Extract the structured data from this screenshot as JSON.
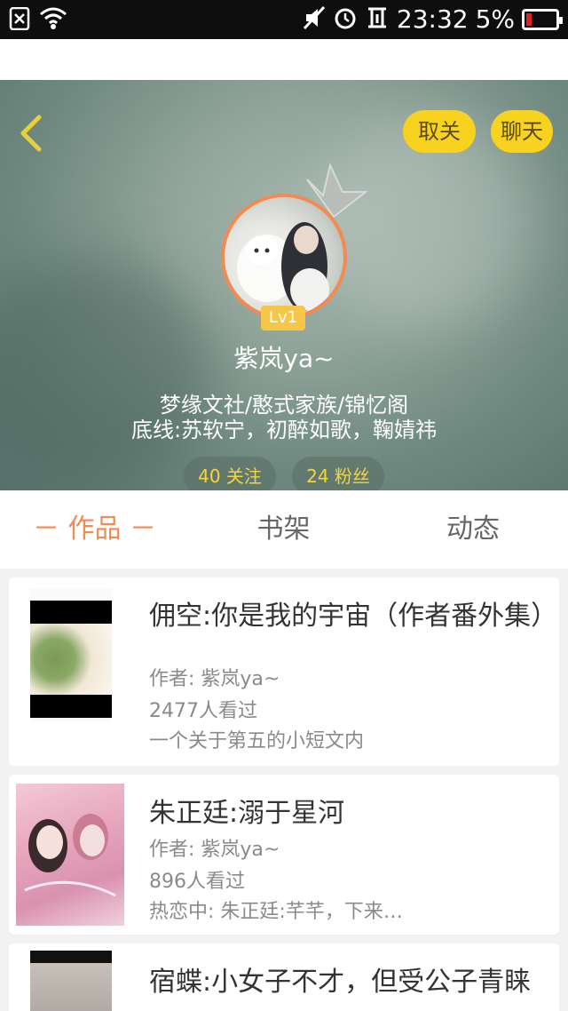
{
  "status_bar": {
    "time": "23:32",
    "battery_percent": "5%",
    "battery_color": "#e0222b",
    "icons": [
      "sim-off-icon",
      "wifi-icon",
      "mute-icon",
      "alarm-icon",
      "signal-icon"
    ]
  },
  "header": {
    "back_icon": "chevron-left-icon",
    "unfollow_label": "取关",
    "chat_label": "聊天",
    "level_badge": "Lv1",
    "username": "紫岚ya~",
    "bio_line1": "梦缘文社/憨式家族/锦忆阁",
    "bio_line2": "底线:苏软宁，初醉如歌，鞠婧祎",
    "following": "40 关注",
    "fans": "24 粉丝",
    "accent_yellow": "#f7d21e",
    "avatar_border": "#f28a52"
  },
  "tabs": [
    {
      "label": "－ 作品 －",
      "active": true
    },
    {
      "label": "书架",
      "active": false
    },
    {
      "label": "动态",
      "active": false
    }
  ],
  "works": [
    {
      "title": "佣空:你是我的宇宙（作者番外集）",
      "author": "作者: 紫岚ya~",
      "views": "2477人看过",
      "desc": "一个关于第五的小短文内"
    },
    {
      "title": "朱正廷:溺于星河",
      "author": "作者: 紫岚ya~",
      "views": "896人看过",
      "desc": "热恋中: 朱正廷:芊芊，下来…"
    },
    {
      "title": "宿蝶:小女子不才，但受公子青睐"
    }
  ]
}
